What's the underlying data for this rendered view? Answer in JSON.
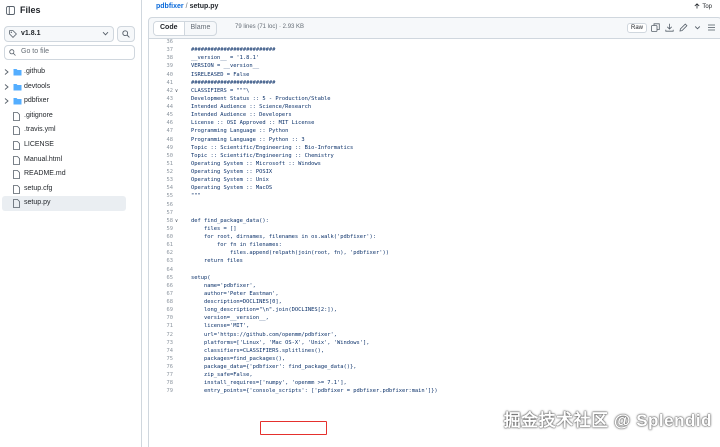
{
  "sidebar": {
    "title": "Files",
    "branch": "v1.8.1",
    "go_to_file_placeholder": "Go to file",
    "items": [
      {
        "name": ".github",
        "type": "folder"
      },
      {
        "name": "devtools",
        "type": "folder"
      },
      {
        "name": "pdbfixer",
        "type": "folder"
      },
      {
        "name": ".gitignore",
        "type": "file"
      },
      {
        "name": ".travis.yml",
        "type": "file"
      },
      {
        "name": "LICENSE",
        "type": "file"
      },
      {
        "name": "Manual.html",
        "type": "file"
      },
      {
        "name": "README.md",
        "type": "file"
      },
      {
        "name": "setup.cfg",
        "type": "file"
      },
      {
        "name": "setup.py",
        "type": "file",
        "selected": true
      }
    ]
  },
  "breadcrumb": {
    "repo": "pdbfixer",
    "separator": "/",
    "file": "setup.py"
  },
  "top_link": "Top",
  "file_header": {
    "tab_code": "Code",
    "tab_blame": "Blame",
    "info": "79 lines (71 loc) · 2.93 KB",
    "raw_label": "Raw"
  },
  "code_lines": [
    {
      "n": "36",
      "t": ""
    },
    {
      "n": "37",
      "t": "##########################"
    },
    {
      "n": "38",
      "t": "__version__ = '1.8.1'"
    },
    {
      "n": "39",
      "t": "VERSION = __version__"
    },
    {
      "n": "40",
      "t": "ISRELEASED = False"
    },
    {
      "n": "41",
      "t": "##########################"
    },
    {
      "n": "42",
      "t": "CLASSIFIERS = \"\"\"\\",
      "fold": true
    },
    {
      "n": "43",
      "t": "Development Status :: 5 - Production/Stable"
    },
    {
      "n": "44",
      "t": "Intended Audience :: Science/Research"
    },
    {
      "n": "45",
      "t": "Intended Audience :: Developers"
    },
    {
      "n": "46",
      "t": "License :: OSI Approved :: MIT License"
    },
    {
      "n": "47",
      "t": "Programming Language :: Python"
    },
    {
      "n": "48",
      "t": "Programming Language :: Python :: 3"
    },
    {
      "n": "49",
      "t": "Topic :: Scientific/Engineering :: Bio-Informatics"
    },
    {
      "n": "50",
      "t": "Topic :: Scientific/Engineering :: Chemistry"
    },
    {
      "n": "51",
      "t": "Operating System :: Microsoft :: Windows"
    },
    {
      "n": "52",
      "t": "Operating System :: POSIX"
    },
    {
      "n": "53",
      "t": "Operating System :: Unix"
    },
    {
      "n": "54",
      "t": "Operating System :: MacOS"
    },
    {
      "n": "55",
      "t": "\"\"\""
    },
    {
      "n": "56",
      "t": ""
    },
    {
      "n": "57",
      "t": ""
    },
    {
      "n": "58",
      "t": "def find_package_data():",
      "fold": true
    },
    {
      "n": "59",
      "t": "    files = []"
    },
    {
      "n": "60",
      "t": "    for root, dirnames, filenames in os.walk('pdbfixer'):"
    },
    {
      "n": "61",
      "t": "        for fn in filenames:"
    },
    {
      "n": "62",
      "t": "            files.append(relpath(join(root, fn), 'pdbfixer'))"
    },
    {
      "n": "63",
      "t": "    return files"
    },
    {
      "n": "64",
      "t": ""
    },
    {
      "n": "65",
      "t": "setup("
    },
    {
      "n": "66",
      "t": "    name='pdbfixer',"
    },
    {
      "n": "67",
      "t": "    author='Peter Eastman',"
    },
    {
      "n": "68",
      "t": "    description=DOCLINES[0],"
    },
    {
      "n": "69",
      "t": "    long_description=\"\\n\".join(DOCLINES[2:]),"
    },
    {
      "n": "70",
      "t": "    version=__version__,"
    },
    {
      "n": "71",
      "t": "    license='MIT',"
    },
    {
      "n": "72",
      "t": "    url='https://github.com/openmm/pdbfixer',"
    },
    {
      "n": "73",
      "t": "    platforms=['Linux', 'Mac OS-X', 'Unix', 'Windows'],"
    },
    {
      "n": "74",
      "t": "    classifiers=CLASSIFIERS.splitlines(),"
    },
    {
      "n": "75",
      "t": "    packages=find_packages(),"
    },
    {
      "n": "76",
      "t": "    package_data={'pdbfixer': find_package_data()},"
    },
    {
      "n": "77",
      "t": "    zip_safe=False,"
    },
    {
      "n": "78",
      "t": "    install_requires=['numpy', 'openmm >= 7.1'],"
    },
    {
      "n": "79",
      "t": "    entry_points={'console_scripts': ['pdbfixer = pdbfixer.pdbfixer:main']})"
    }
  ],
  "watermark": "掘金技术社区 @ Splendid",
  "colors": {
    "link": "#0969da",
    "highlight_box": "#e5302d",
    "line_number": "#8c959f"
  }
}
